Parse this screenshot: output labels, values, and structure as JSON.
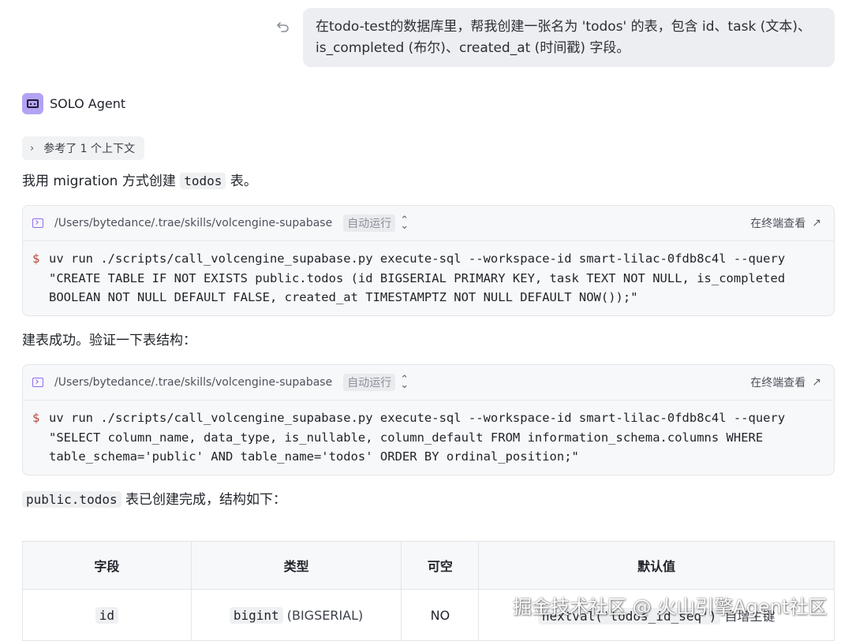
{
  "user_message": {
    "line1": "在todo-test的数据库里，帮我创建一张名为 'todos' 的表，包含 id、task (文本)、",
    "line2": "is_completed (布尔)、created_at (时间戳) 字段。"
  },
  "agent": {
    "name": "SOLO Agent"
  },
  "context_chip": {
    "label": "参考了 1 个上下文"
  },
  "para1": {
    "before": "我用 migration 方式创建",
    "code": "todos",
    "after": "表。"
  },
  "cmd1": {
    "path": "/Users/bytedance/.trae/skills/volcengine-supabase",
    "auto_run": "自动运行",
    "open_terminal": "在终端查看",
    "dollar": "$",
    "command": "uv run ./scripts/call_volcengine_supabase.py execute-sql --workspace-id smart-lilac-0fdb8c4l --query\n\"CREATE TABLE IF NOT EXISTS public.todos (id BIGSERIAL PRIMARY KEY, task TEXT NOT NULL, is_completed\nBOOLEAN NOT NULL DEFAULT FALSE, created_at TIMESTAMPTZ NOT NULL DEFAULT NOW());\""
  },
  "para2": {
    "text": "建表成功。验证一下表结构："
  },
  "cmd2": {
    "path": "/Users/bytedance/.trae/skills/volcengine-supabase",
    "auto_run": "自动运行",
    "open_terminal": "在终端查看",
    "dollar": "$",
    "command": "uv run ./scripts/call_volcengine_supabase.py execute-sql --workspace-id smart-lilac-0fdb8c4l --query\n\"SELECT column_name, data_type, is_nullable, column_default FROM information_schema.columns WHERE\ntable_schema='public' AND table_name='todos' ORDER BY ordinal_position;\""
  },
  "para3": {
    "code": "public.todos",
    "after": "表已创建完成，结构如下："
  },
  "table": {
    "headers": [
      "字段",
      "类型",
      "可空",
      "默认值"
    ],
    "row1": {
      "field": "id",
      "type_code": "bigint",
      "type_extra": "(BIGSERIAL)",
      "nullable": "NO",
      "default_code": "nextval('todos_id_seq')",
      "default_extra": "自增主键"
    }
  },
  "watermark": "掘金技术社区 @ 火山引擎Agent社区"
}
